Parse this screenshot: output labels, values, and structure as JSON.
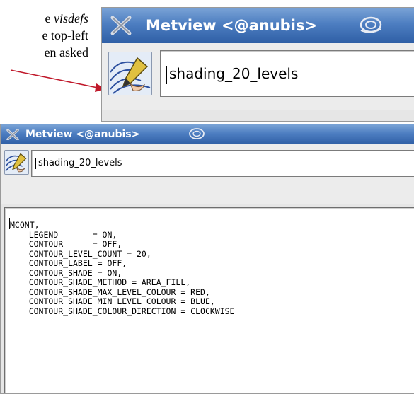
{
  "doc_excerpt": {
    "lines": [
      "e visdefs",
      "e top-left",
      "en  asked"
    ],
    "italic_word": "visdefs"
  },
  "window_big": {
    "title": "Metview <@anubis>",
    "icon_name_value": "shading_20_levels",
    "title_icons": [
      "x-icon",
      "swirl-icon"
    ],
    "app_icon": "contour-pen-icon"
  },
  "window_small": {
    "title": "Metview <@anubis>",
    "icon_name_value": "shading_20_levels",
    "title_icons": [
      "x-icon",
      "swirl-icon"
    ],
    "app_icon": "contour-pen-icon",
    "editor_lines": [
      "MCONT,",
      "    LEGEND       = ON,",
      "    CONTOUR      = OFF,",
      "    CONTOUR_LEVEL_COUNT = 20,",
      "    CONTOUR_LABEL = OFF,",
      "    CONTOUR_SHADE = ON,",
      "    CONTOUR_SHADE_METHOD = AREA_FILL,",
      "    CONTOUR_SHADE_MAX_LEVEL_COLOUR = RED,",
      "    CONTOUR_SHADE_MIN_LEVEL_COLOUR = BLUE,",
      "    CONTOUR_SHADE_COLOUR_DIRECTION = CLOCKWISE"
    ]
  },
  "colors": {
    "titlebar": "#4d7ec1",
    "arrow": "#c0182a"
  }
}
